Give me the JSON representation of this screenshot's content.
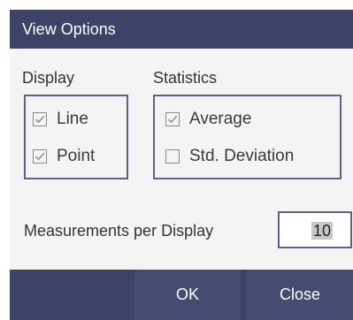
{
  "dialog": {
    "title": "View Options",
    "display": {
      "label": "Display",
      "options": [
        {
          "label": "Line",
          "checked": true
        },
        {
          "label": "Point",
          "checked": true
        }
      ]
    },
    "statistics": {
      "label": "Statistics",
      "options": [
        {
          "label": "Average",
          "checked": true
        },
        {
          "label": "Std. Deviation",
          "checked": false
        }
      ]
    },
    "measurements": {
      "label": "Measurements per Display",
      "value": "10"
    },
    "buttons": {
      "ok": "OK",
      "close": "Close"
    },
    "colors": {
      "header": "#3c4367",
      "button": "#454c72",
      "border": "#5d6388",
      "background": "#f4f4f4"
    }
  }
}
